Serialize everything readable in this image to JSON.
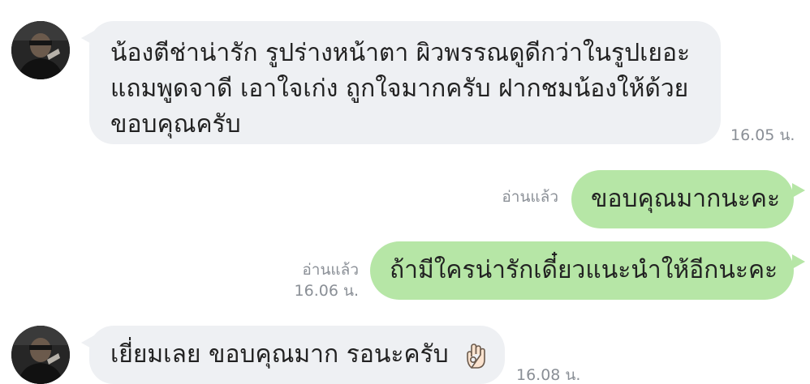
{
  "messages": [
    {
      "direction": "incoming",
      "lines": [
        "น้องตีช่าน่ารัก รูปร่างหน้าตา ผิวพรรณดูดีกว่าในรูปเยอะ",
        "แถมพูดจาดี เอาใจเก่ง ถูกใจมากครับ ฝากชมน้องให้ด้วย",
        "ขอบคุณครับ"
      ],
      "time": "16.05 น."
    },
    {
      "direction": "outgoing",
      "text": "ขอบคุณมากนะคะ",
      "read": "อ่านแล้ว"
    },
    {
      "direction": "outgoing",
      "text": "ถ้ามีใครน่ารักเดี๋ยวแนะนำให้อีกนะคะ",
      "read": "อ่านแล้ว",
      "time": "16.06 น."
    },
    {
      "direction": "incoming",
      "text": "เยี่ยมเลย ขอบคุณมาก รอนะครับ",
      "emoji": "ok-hand-emoji",
      "time": "16.08 น."
    }
  ],
  "colors": {
    "incoming_bubble": "#eef0f3",
    "outgoing_bubble": "#b6e6a6",
    "meta_text": "#8a8f96",
    "message_text": "#222222"
  }
}
